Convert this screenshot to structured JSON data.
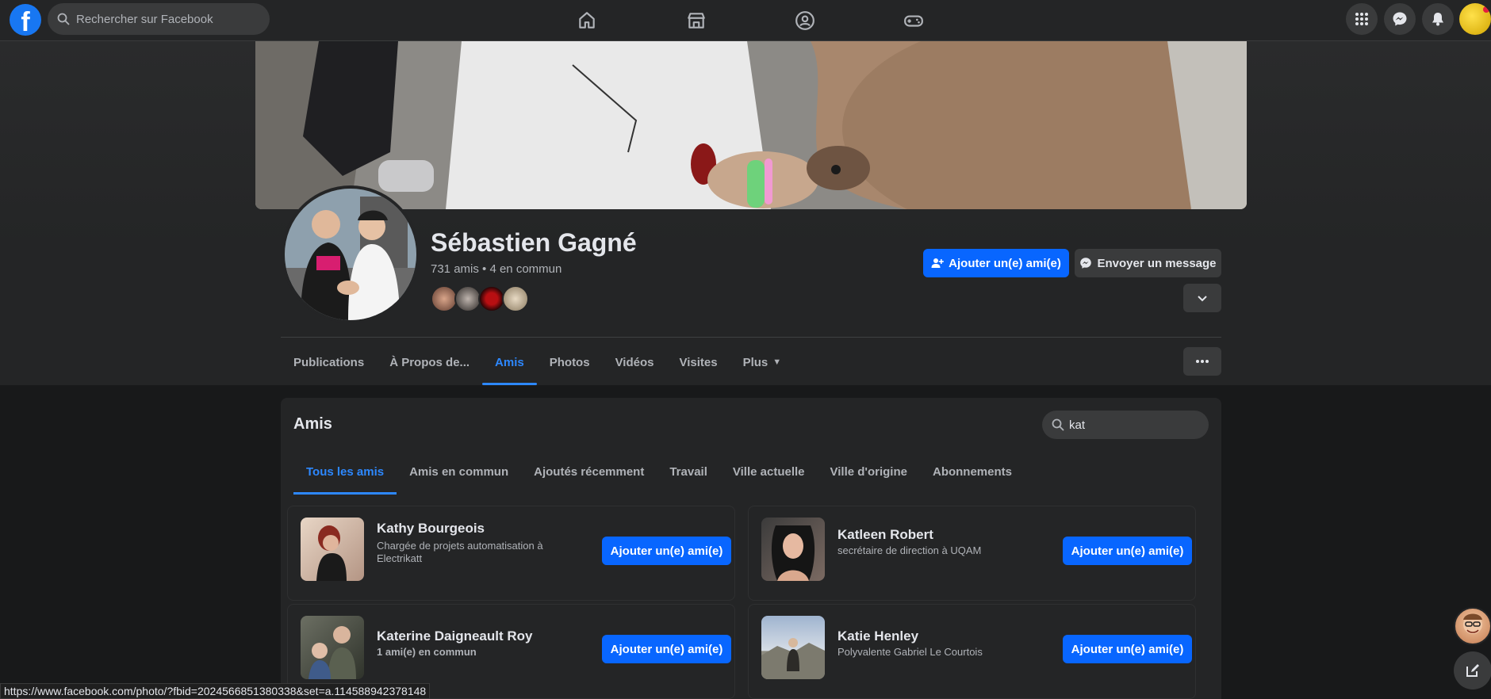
{
  "topbar": {
    "logo_letter": "f",
    "search_placeholder": "Rechercher sur Facebook",
    "nav_icons": [
      "home-icon",
      "marketplace-icon",
      "groups-icon",
      "gaming-icon"
    ],
    "right_icons": [
      "menu-grid-icon",
      "messenger-icon",
      "notifications-icon"
    ]
  },
  "profile": {
    "name": "Sébastien Gagné",
    "meta": "731 amis • 4 en commun",
    "add_friend_label": "Ajouter un(e) ami(e)",
    "message_label": "Envoyer un message",
    "tabs": [
      {
        "label": "Publications"
      },
      {
        "label": "À Propos de..."
      },
      {
        "label": "Amis"
      },
      {
        "label": "Photos"
      },
      {
        "label": "Vidéos"
      },
      {
        "label": "Visites"
      },
      {
        "label": "Plus"
      }
    ],
    "active_tab": "Amis"
  },
  "friends": {
    "title": "Amis",
    "search_value": "kat",
    "subtabs": [
      {
        "label": "Tous les amis"
      },
      {
        "label": "Amis en commun"
      },
      {
        "label": "Ajoutés récemment"
      },
      {
        "label": "Travail"
      },
      {
        "label": "Ville actuelle"
      },
      {
        "label": "Ville d'origine"
      },
      {
        "label": "Abonnements"
      }
    ],
    "list": [
      {
        "name": "Kathy Bourgeois",
        "desc": "Chargée de projets automatisation à Electrikatt",
        "button": "Ajouter un(e) ami(e)"
      },
      {
        "name": "Katleen Robert",
        "desc": "secrétaire de direction à UQAM",
        "button": "Ajouter un(e) ami(e)"
      },
      {
        "name": "Katerine Daigneault Roy",
        "desc": "1 ami(e) en commun",
        "button": "Ajouter un(e) ami(e)"
      },
      {
        "name": "Katie Henley",
        "desc": "Polyvalente Gabriel Le Courtois",
        "button": "Ajouter un(e) ami(e)"
      }
    ]
  },
  "status_url": "https://www.facebook.com/photo/?fbid=2024566851380338&set=a.114588942378148",
  "colors": {
    "background": "#18191a",
    "surface": "#242526",
    "accent": "#0866ff",
    "active_tab": "#2d88ff"
  }
}
